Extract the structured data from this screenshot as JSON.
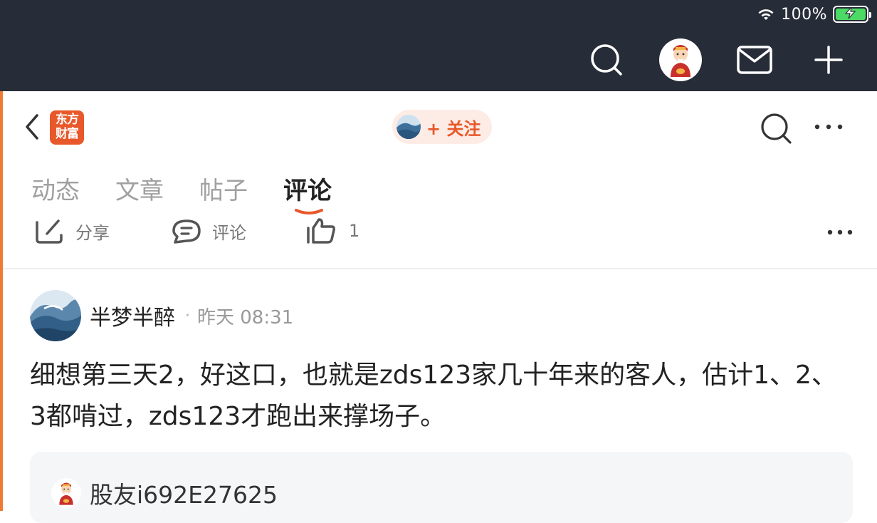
{
  "status": {
    "battery_percent": "100%",
    "battery_level": 1.0,
    "charging": true
  },
  "top_nav": {
    "icons": [
      "search-icon",
      "avatar",
      "mail-icon",
      "plus-icon"
    ]
  },
  "header": {
    "logo_line1": "东方",
    "logo_line2": "财富",
    "follow_label": "+ 关注"
  },
  "tabs": [
    {
      "label": "动态",
      "active": false
    },
    {
      "label": "文章",
      "active": false
    },
    {
      "label": "帖子",
      "active": false
    },
    {
      "label": "评论",
      "active": true
    }
  ],
  "actions": {
    "share_label": "分享",
    "comment_label": "评论",
    "like_count": "1"
  },
  "post": {
    "author": "半梦半醉",
    "separator": "·",
    "time": "昨天 08:31",
    "body": "细想第三天2，好这口，也就是zds123家几十年来的客人，估计1、2、3都啃过，zds123才跑出来撑场子。"
  },
  "quote": {
    "username": "股友i692E27625"
  },
  "colors": {
    "top_bar": "#272d38",
    "accent": "#e8582a",
    "follow_bg": "#fdece6",
    "quote_bg": "#f5f6f8"
  }
}
